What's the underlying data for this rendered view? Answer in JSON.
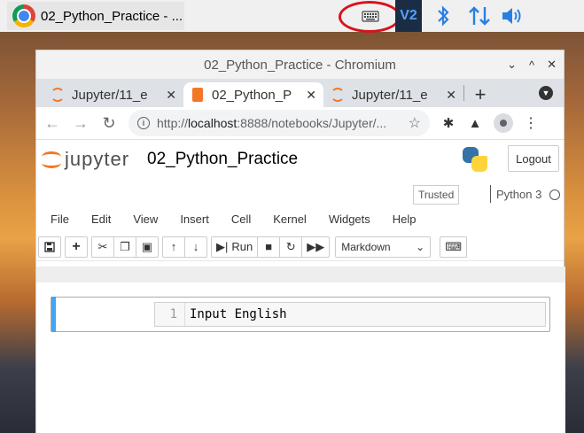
{
  "taskbar": {
    "app_title": "02_Python_Practice - ...",
    "tray_icons": [
      "keyboard-icon",
      "vnc-icon",
      "bluetooth-icon",
      "network-icon",
      "volume-icon"
    ]
  },
  "window": {
    "title": "02_Python_Practice - Chromium",
    "controls": [
      "⌄",
      "^",
      "✕"
    ]
  },
  "tabs": [
    {
      "label": "Jupyter/11_e",
      "icon": "jupyter-icon"
    },
    {
      "label": "02_Python_P",
      "icon": "notebook-icon",
      "active": true
    },
    {
      "label": "Jupyter/11_e",
      "icon": "jupyter-icon"
    }
  ],
  "tab_close": "✕",
  "new_tab": "+",
  "omnibox": {
    "url_prefix": "http://",
    "url_host": "localhost",
    "url_rest": ":8888/notebooks/Jupyter/..."
  },
  "jupyter": {
    "logo_text": "jupyter",
    "notebook_name": "02_Python_Practice",
    "logout_label": "Logout",
    "trusted_label": "Trusted",
    "kernel_name": "Python 3",
    "menu": [
      "File",
      "Edit",
      "View",
      "Insert",
      "Cell",
      "Kernel",
      "Widgets",
      "Help"
    ],
    "run_label": "Run",
    "cell_type": "Markdown"
  },
  "cell": {
    "line_number": "1",
    "source": "Input English"
  },
  "colors": {
    "accent": "#f37726",
    "cell_selected": "#42a5f5",
    "tray_blue": "#2b7fe0",
    "highlight_circle": "#d8121b"
  }
}
